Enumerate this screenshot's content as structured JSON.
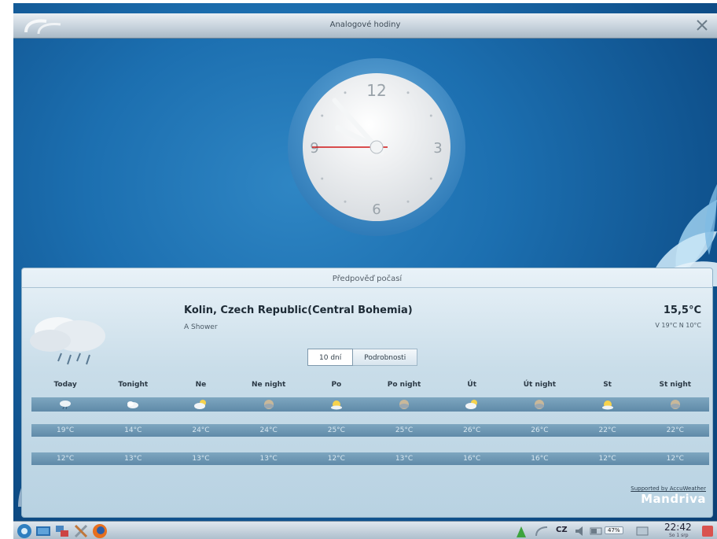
{
  "clock_window": {
    "title": "Analogové hodiny",
    "clock": {
      "numerals": [
        "12",
        "3",
        "6",
        "9"
      ],
      "hour": 9,
      "minute": 53,
      "second": 45
    }
  },
  "weather_window": {
    "title": "Předpověď počasí",
    "location": "Kolin, Czech Republic(Central Bohemia)",
    "condition": "A Shower",
    "current_temp": "15,5°C",
    "hi_lo": "V 19°C N 10°C",
    "tabs": [
      {
        "label": "10 dní",
        "active": true
      },
      {
        "label": "Podrobnosti",
        "active": false
      }
    ],
    "forecast": [
      {
        "day": "Today",
        "icon": "rain-cloud-icon",
        "high": "19°C",
        "low": "12°C"
      },
      {
        "day": "Tonight",
        "icon": "cloud-icon",
        "high": "14°C",
        "low": "13°C"
      },
      {
        "day": "Ne",
        "icon": "partly-cloudy-icon",
        "high": "24°C",
        "low": "13°C"
      },
      {
        "day": "Ne night",
        "icon": "night-cloud-icon",
        "high": "24°C",
        "low": "13°C"
      },
      {
        "day": "Po",
        "icon": "sun-cloud-icon",
        "high": "25°C",
        "low": "12°C"
      },
      {
        "day": "Po night",
        "icon": "night-cloud-icon",
        "high": "25°C",
        "low": "13°C"
      },
      {
        "day": "Út",
        "icon": "partly-cloudy-icon",
        "high": "26°C",
        "low": "16°C"
      },
      {
        "day": "Út night",
        "icon": "night-cloud-icon",
        "high": "26°C",
        "low": "16°C"
      },
      {
        "day": "St",
        "icon": "sun-cloud-icon",
        "high": "22°C",
        "low": "12°C"
      },
      {
        "day": "St night",
        "icon": "night-cloud-icon",
        "high": "22°C",
        "low": "12°C"
      }
    ],
    "credit": "Supported by AccuWeather",
    "brand": "Mandriva"
  },
  "taskbar": {
    "language": "CZ",
    "percent": "47%",
    "time": "22:42",
    "date": "So 1 srp"
  },
  "colors": {
    "desktop_blue": "#1c6fb0",
    "clock_ring": "#4f9bd0",
    "second_hand": "#d01515",
    "forecast_band": "#6f97b4"
  }
}
